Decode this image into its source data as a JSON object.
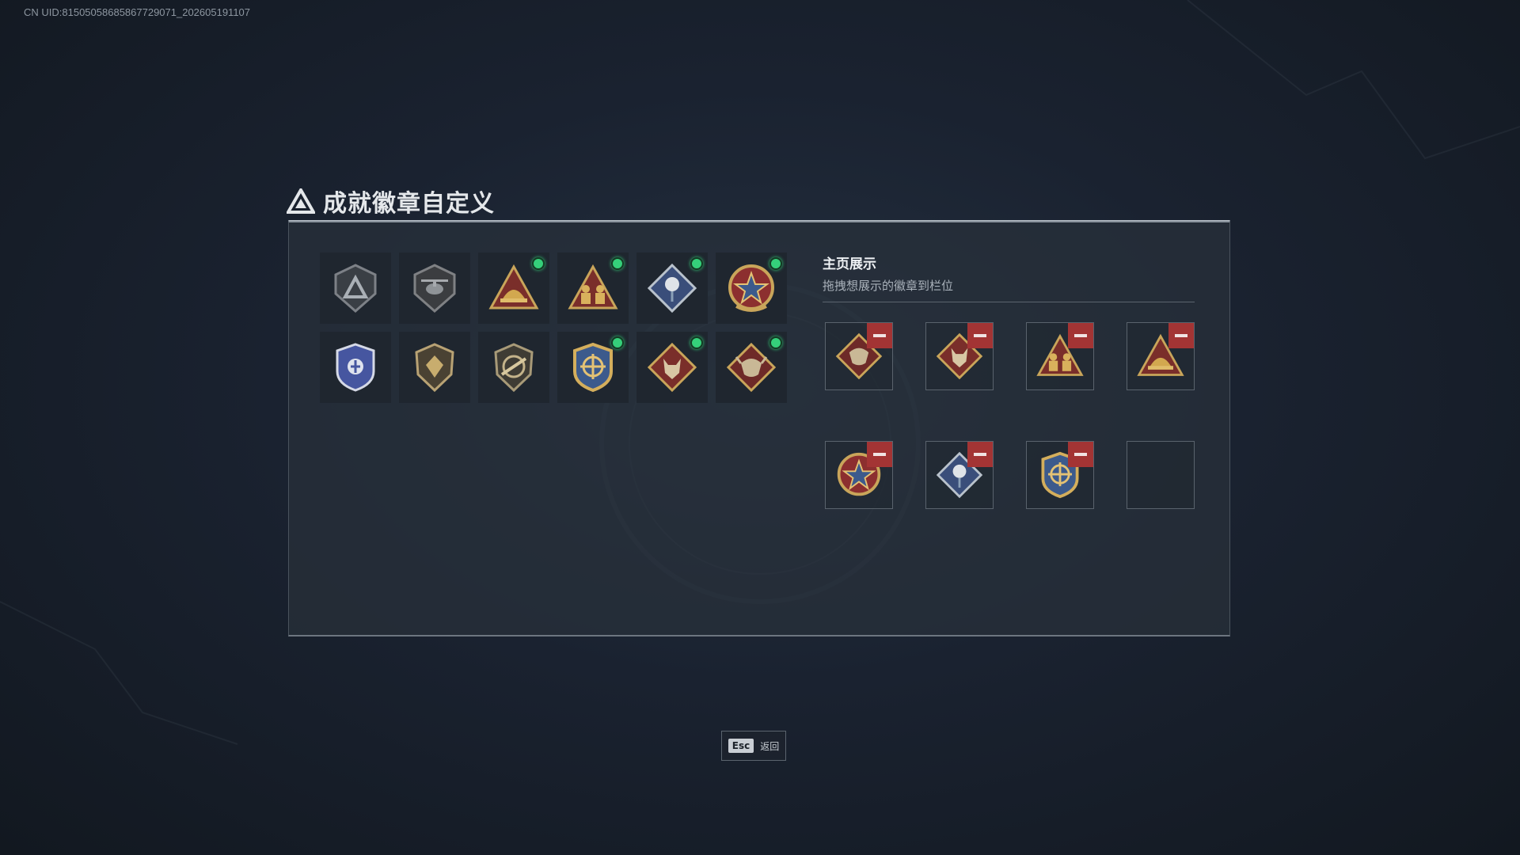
{
  "uid_text": "CN UID:8150505868586772907​1_202605191107",
  "page_title": "成就徽章自定义",
  "badges": [
    {
      "icon": "triangle-shield-badge-icon",
      "new": false
    },
    {
      "icon": "helicopter-shield-badge-icon",
      "new": false
    },
    {
      "icon": "helmet-triangle-badge-icon",
      "new": true
    },
    {
      "icon": "soldiers-triangle-badge-icon",
      "new": true
    },
    {
      "icon": "rose-diamond-badge-icon",
      "new": true
    },
    {
      "icon": "star-round-badge-icon",
      "new": true
    },
    {
      "icon": "police-shield-badge-icon",
      "new": false
    },
    {
      "icon": "gem-shield-badge-icon",
      "new": false
    },
    {
      "icon": "rifle-shield-badge-icon",
      "new": false
    },
    {
      "icon": "crosshair-shield-badge-icon",
      "new": true
    },
    {
      "icon": "wolf-diamond-badge-icon",
      "new": true
    },
    {
      "icon": "dragon-diamond-badge-icon",
      "new": true
    }
  ],
  "showcase": {
    "title": "主页展示",
    "subtitle": "拖拽想展示的徽章到栏位",
    "slots": [
      {
        "icon": "dragon-diamond-badge-icon",
        "filled": true
      },
      {
        "icon": "wolf-diamond-badge-icon",
        "filled": true
      },
      {
        "icon": "soldiers-triangle-badge-icon",
        "filled": true
      },
      {
        "icon": "helmet-triangle-badge-icon",
        "filled": true
      },
      {
        "icon": "star-round-badge-icon",
        "filled": true
      },
      {
        "icon": "rose-diamond-badge-icon",
        "filled": true
      },
      {
        "icon": "crosshair-shield-badge-icon",
        "filled": true
      },
      {
        "icon": "",
        "filled": false
      }
    ]
  },
  "esc": {
    "key": "Esc",
    "label": "返回"
  },
  "colors": {
    "accent_new": "#35d07a",
    "remove": "#a33434",
    "gold": "#c9a55a",
    "red_badge": "#7a2e2a"
  }
}
